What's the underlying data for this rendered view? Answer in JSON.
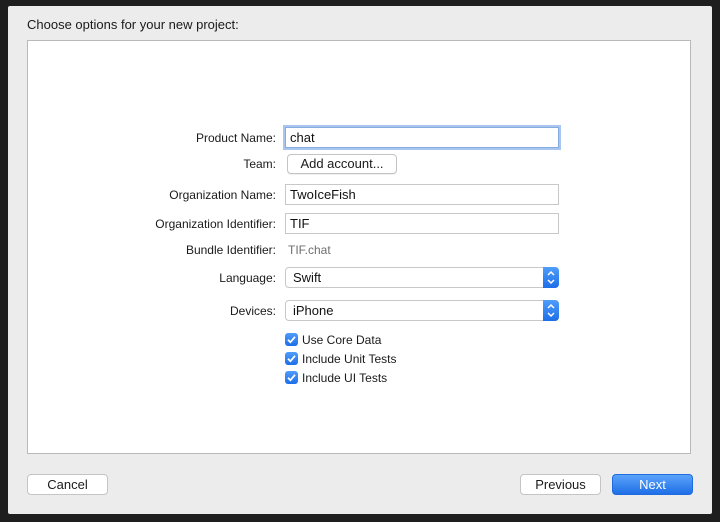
{
  "dialog": {
    "heading": "Choose options for your new project:"
  },
  "form": {
    "product_name": {
      "label": "Product Name:",
      "value": "chat"
    },
    "team": {
      "label": "Team:",
      "button": "Add account..."
    },
    "organization_name": {
      "label": "Organization Name:",
      "value": "TwoIceFish"
    },
    "organization_identifier": {
      "label": "Organization Identifier:",
      "value": "TIF"
    },
    "bundle_identifier": {
      "label": "Bundle Identifier:",
      "value": "TIF.chat"
    },
    "language": {
      "label": "Language:",
      "selected": "Swift"
    },
    "devices": {
      "label": "Devices:",
      "selected": "iPhone"
    },
    "options": [
      {
        "label": "Use Core Data",
        "checked": true
      },
      {
        "label": "Include Unit Tests",
        "checked": true
      },
      {
        "label": "Include UI Tests",
        "checked": true
      }
    ]
  },
  "footer": {
    "cancel": "Cancel",
    "previous": "Previous",
    "next": "Next"
  },
  "colors": {
    "accent": "#1d6ee8",
    "focus_ring": "#a8c6f0",
    "window_bg": "#ececec",
    "backdrop": "#1e1e1e"
  },
  "icons": {
    "popup_arrows": "up-down-chevron-icon",
    "checkbox": "checkmark-icon"
  }
}
